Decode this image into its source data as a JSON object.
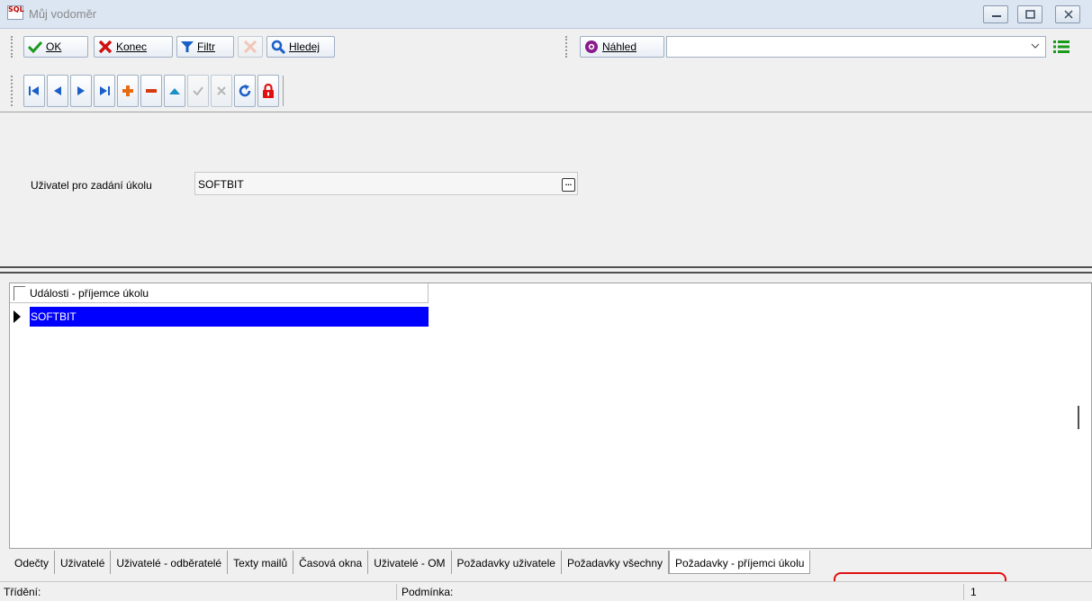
{
  "window": {
    "logo_text": "SQL",
    "title": "Můj vodoměr"
  },
  "toolbar": {
    "ok_label": "OK",
    "konec_label": "Konec",
    "filtr_label": "Filtr",
    "hledej_label": "Hledej",
    "nahled_label": "Náhled",
    "combo_value": ""
  },
  "nav_buttons": [
    {
      "name": "first-record",
      "icon": "skip-first-icon",
      "enabled": true
    },
    {
      "name": "prev-record",
      "icon": "prev-icon",
      "enabled": true
    },
    {
      "name": "next-record",
      "icon": "next-icon",
      "enabled": true
    },
    {
      "name": "last-record",
      "icon": "skip-last-icon",
      "enabled": true
    },
    {
      "name": "add-record",
      "icon": "plus-icon",
      "enabled": true
    },
    {
      "name": "delete-record",
      "icon": "minus-icon",
      "enabled": true
    },
    {
      "name": "edit-record",
      "icon": "triangle-up-icon",
      "enabled": true
    },
    {
      "name": "post-record",
      "icon": "check-icon",
      "enabled": false
    },
    {
      "name": "cancel-record",
      "icon": "x-icon",
      "enabled": false
    },
    {
      "name": "refresh",
      "icon": "refresh-icon",
      "enabled": true
    },
    {
      "name": "lock",
      "icon": "lock-icon",
      "enabled": true
    }
  ],
  "form": {
    "user_label": "Uživatel pro zadání úkolu",
    "user_value": "SOFTBIT",
    "ellipsis": "..."
  },
  "grid": {
    "column_header": "Události - příjemce úkolu",
    "rows": [
      "SOFTBIT"
    ]
  },
  "tabs": [
    "Odečty",
    "Uživatelé",
    "Uživatelé - odběratelé",
    "Texty mailů",
    "Časová okna",
    "Uživatelé - OM",
    "Požadavky uživatele",
    "Požadavky všechny",
    "Požadavky - příjemci úkolu"
  ],
  "active_tab": "Požadavky - příjemci úkolu",
  "status": {
    "sort_label": "Třídění:",
    "condition_label": "Podmínka:",
    "count": "1"
  },
  "colors": {
    "selection": "#0000ff",
    "highlight": "#e01010",
    "titlebar": "#dbe6f2"
  }
}
